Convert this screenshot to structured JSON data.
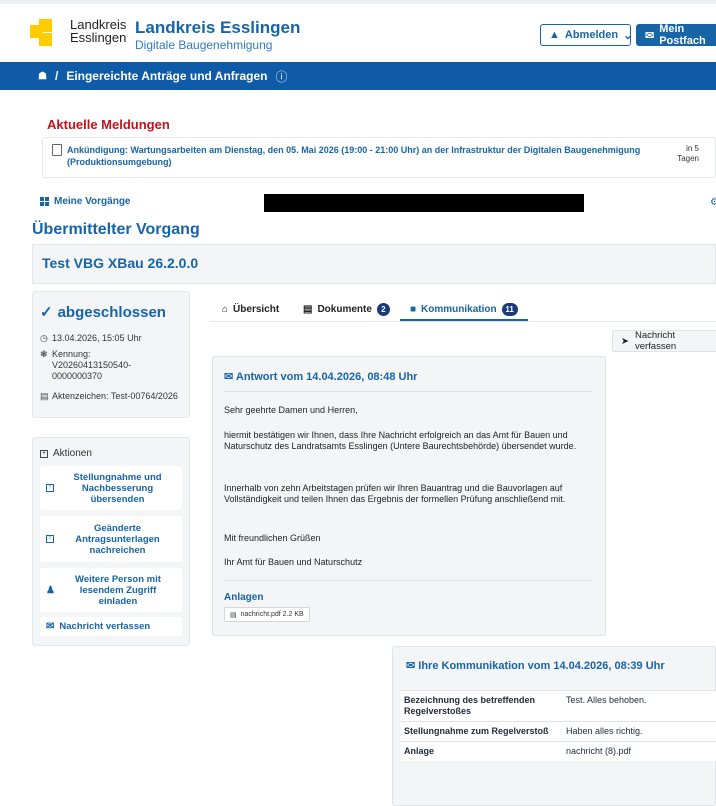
{
  "header": {
    "logo_text_line1": "Landkreis",
    "logo_text_line2": "Esslingen",
    "title": "Landkreis Esslingen",
    "subtitle": "Digitale Baugenehmigung",
    "logout_label": "Abmelden",
    "mailbox_label": "Mein Postfach"
  },
  "nav": {
    "breadcrumb_sep": "/",
    "breadcrumb_label": "Eingereichte Anträge und Anfragen"
  },
  "news": {
    "title": "Aktuelle Meldungen",
    "items": [
      {
        "text": "Ankündigung: Wartungsarbeiten am Dienstag, den 05. Mai 2026 (19:00 - 21:00 Uhr) an der Infrastruktur der Digitalen Baugenehmigung (Produktionsumgebung)",
        "when": "in 5 Tagen"
      }
    ]
  },
  "vorgaenge_link": "Meine Vorgänge",
  "page_heading": "Übermittelter Vorgang",
  "case_title": "Test VBG XBau 26.2.0.0",
  "status": {
    "label": "abgeschlossen",
    "date": "13.04.2026, 15:05 Uhr",
    "kennung_label": "Kennung:",
    "kennung_value": "V20260413150540-0000000370",
    "aktenzeichen": "Aktenzeichen: Test-00764/2026"
  },
  "actions": {
    "title": "Aktionen",
    "items": [
      {
        "label": "Stellungnahme und Nachbesserung übersenden"
      },
      {
        "label": "Geänderte Antragsunterlagen nachreichen"
      },
      {
        "label": "Weitere Person mit lesendem Zugriff einladen"
      },
      {
        "label": "Nachricht verfassen"
      }
    ]
  },
  "tabs": [
    {
      "label": "Übersicht"
    },
    {
      "label": "Dokumente",
      "badge": "2"
    },
    {
      "label": "Kommunikation",
      "badge": "11",
      "active": true
    }
  ],
  "new_message_button": "Nachricht verfassen",
  "message": {
    "title": "Antwort vom 14.04.2026, 08:48 Uhr",
    "greeting": "Sehr geehrte Damen und Herren,",
    "p1": "hiermit bestätigen wir Ihnen, dass Ihre Nachricht erfolgreich an das Amt für Bauen und Naturschutz des Landratsamts Esslingen (Untere Baurechtsbehörde) übersendet wurde.",
    "p2": "Innerhalb von zehn Arbeitstagen prüfen wir Ihren Bauantrag und die Bauvorlagen auf Vollständigkeit und teilen Ihnen das Ergebnis der formellen Prüfung anschließend mit.",
    "regards": "Mit freundlichen Grüßen",
    "sender": "Ihr Amt für Bauen und Naturschutz",
    "attachments_title": "Anlagen",
    "attachment": "nachricht.pdf 2.2 KB"
  },
  "own_message": {
    "title": "Ihre Kommunikation vom 14.04.2026, 08:39 Uhr",
    "rows": [
      {
        "key": "Bezeichnung des betreffenden Regelverstoßes",
        "value": "Test. Alles behoben."
      },
      {
        "key": "Stellungnahme zum Regelverstoß",
        "value": "Haben alles richtig."
      },
      {
        "key": "Anlage",
        "value": "nachricht (8).pdf"
      }
    ]
  },
  "colors": {
    "brand_blue": "#1764a7",
    "nav_blue": "#0f5ba7",
    "alert_red": "#c1121f",
    "logo_yellow": "#ffcc00"
  }
}
